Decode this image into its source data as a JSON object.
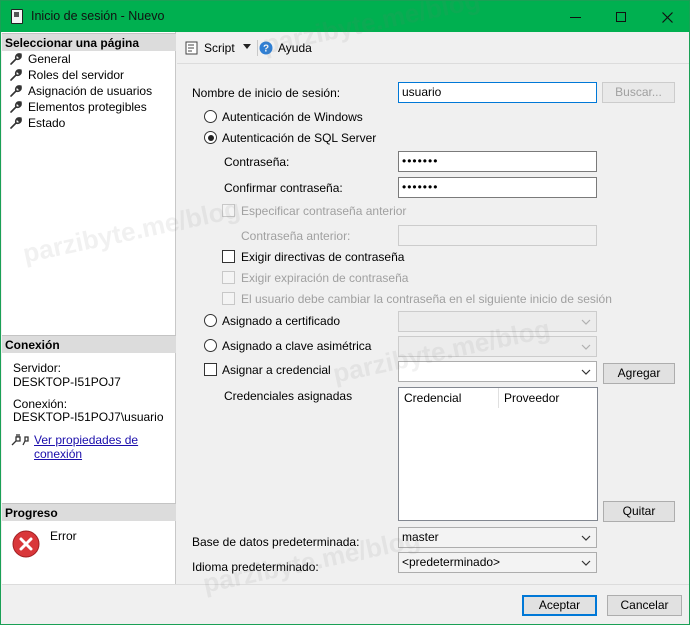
{
  "window": {
    "title": "Inicio de sesión - Nuevo"
  },
  "sidebar": {
    "select_page_header": "Seleccionar una página",
    "pages": [
      {
        "label": "General"
      },
      {
        "label": "Roles del servidor"
      },
      {
        "label": "Asignación de usuarios"
      },
      {
        "label": "Elementos protegibles"
      },
      {
        "label": "Estado"
      }
    ],
    "connection_header": "Conexión",
    "server_label": "Servidor:",
    "server_value": "DESKTOP-I51POJ7",
    "connection_label": "Conexión:",
    "connection_value": "DESKTOP-I51POJ7\\usuario",
    "view_properties_link": "Ver propiedades de conexión",
    "progress_header": "Progreso",
    "progress_status": "Error"
  },
  "toolbar": {
    "script_label": "Script",
    "help_label": "Ayuda"
  },
  "form": {
    "login_name_label": "Nombre de inicio de sesión:",
    "login_name_value": "usuario",
    "search_button": "Buscar...",
    "windows_auth_label": "Autenticación de Windows",
    "sql_auth_label": "Autenticación de SQL Server",
    "password_label": "Contraseña:",
    "password_value": "•••••••",
    "confirm_password_label": "Confirmar contraseña:",
    "confirm_password_value": "•••••••",
    "specify_old_password_label": "Especificar contraseña anterior",
    "old_password_label": "Contraseña anterior:",
    "enforce_policy_label": "Exigir directivas de contraseña",
    "enforce_expiration_label": "Exigir expiración de contraseña",
    "must_change_label": "El usuario debe cambiar la contraseña en el siguiente inicio de sesión",
    "mapped_cert_label": "Asignado a certificado",
    "mapped_asym_key_label": "Asignado a clave asimétrica",
    "map_credential_label": "Asignar a credencial",
    "add_button": "Agregar",
    "assigned_credentials_label": "Credenciales asignadas",
    "grid_columns": [
      "Credencial",
      "Proveedor"
    ],
    "remove_button": "Quitar",
    "default_db_label": "Base de datos predeterminada:",
    "default_db_value": "master",
    "default_lang_label": "Idioma predeterminado:",
    "default_lang_value": "<predeterminado>"
  },
  "footer": {
    "ok_button": "Aceptar",
    "cancel_button": "Cancelar"
  },
  "watermark_text": "parzibyte.me/blog"
}
